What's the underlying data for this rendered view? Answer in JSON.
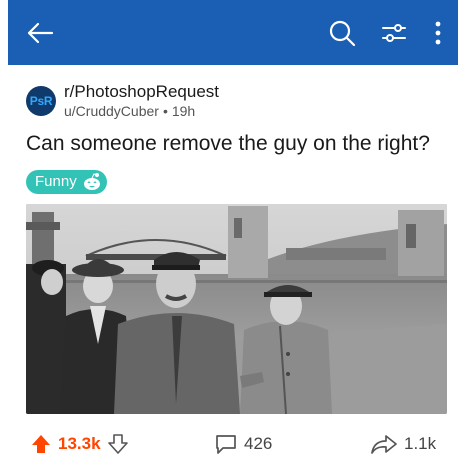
{
  "topbar": {
    "color": "#1a5fb4",
    "icons": [
      "back-arrow-icon",
      "search-icon",
      "filter-icon",
      "more-vertical-icon"
    ]
  },
  "post": {
    "subreddit": "r/PhotoshopRequest",
    "subreddit_icon_text": "PsR",
    "author": "u/CruddyCuber",
    "separator": "•",
    "age": "19h",
    "title": "Can someone remove the guy on the right?",
    "flair": "Funny",
    "flair_color": "#33c3b6"
  },
  "actions": {
    "upvotes": "13.3k",
    "comments": "426",
    "shares": "1.1k",
    "upvote_color": "#ff4500"
  }
}
